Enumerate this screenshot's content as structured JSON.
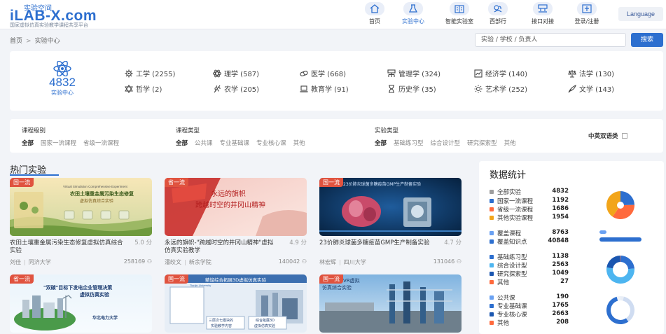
{
  "header": {
    "logo_cn": "实验空间",
    "logo_en": "iLAB-X.com",
    "logo_sub": "国家虚拟仿真实验教学课程共享平台",
    "nav": [
      {
        "label": "首页",
        "icon": "home-icon"
      },
      {
        "label": "实验中心",
        "icon": "flask-icon"
      },
      {
        "label": "智能实验室",
        "icon": "book-icon"
      },
      {
        "label": "西部行",
        "icon": "handshake-icon"
      },
      {
        "label": "接口对接",
        "icon": "network-icon"
      },
      {
        "label": "登录/注册",
        "icon": "user-login-icon"
      }
    ],
    "active_nav": "实验中心",
    "language": "Language"
  },
  "breadcrumb": {
    "home": "首页",
    "sep": ">",
    "current": "实验中心"
  },
  "search": {
    "placeholder": "实验 / 学校 / 负责人",
    "button": "搜索"
  },
  "categories": {
    "total": "4832",
    "total_label": "实验中心",
    "items": [
      {
        "label": "工学 (2255)",
        "icon": "gear-icon"
      },
      {
        "label": "理学 (587)",
        "icon": "atom-icon"
      },
      {
        "label": "医学 (668)",
        "icon": "pill-icon"
      },
      {
        "label": "管理学 (324)",
        "icon": "org-chart-icon"
      },
      {
        "label": "经济学 (140)",
        "icon": "chart-line-icon"
      },
      {
        "label": "法学 (130)",
        "icon": "scales-icon"
      },
      {
        "label": "哲学 (2)",
        "icon": "star-of-david-icon"
      },
      {
        "label": "农学 (205)",
        "icon": "wheat-icon"
      },
      {
        "label": "教育学 (91)",
        "icon": "laptop-icon"
      },
      {
        "label": "历史学 (35)",
        "icon": "hourglass-icon"
      },
      {
        "label": "艺术学 (252)",
        "icon": "sun-icon"
      },
      {
        "label": "文学 (143)",
        "icon": "quill-icon"
      }
    ]
  },
  "filters": {
    "groups": [
      {
        "title": "课程级别",
        "options": [
          "全部",
          "国家一流课程",
          "省级一流课程"
        ]
      },
      {
        "title": "课程类型",
        "options": [
          "全部",
          "公共课",
          "专业基础课",
          "专业核心课",
          "其他"
        ]
      },
      {
        "title": "实验类型",
        "options": [
          "全部",
          "基础练习型",
          "综合设计型",
          "研究探索型",
          "其他"
        ]
      }
    ],
    "bilingual": "中英双语类"
  },
  "hot": {
    "title": "热门实验",
    "cards": [
      {
        "badge": "国一流",
        "image_text": [
          "Virtual Simulation Comprehensive Experiment",
          "农田土壤重金属污染生态修复",
          "虚拟仿真综合实验"
        ],
        "title": "农田土壤重金属污染生态修复虚拟仿真综合实验",
        "score": "5.0 分",
        "author": "刘佳",
        "school": "同济大学",
        "views": "258169"
      },
      {
        "badge": "省一流",
        "image_text": [
          "永远的旗帜",
          "跨越时空的井冈山精神"
        ],
        "title": "永远的旗帜-\"跨越时空的井冈山精神\"虚拟仿真实验教学",
        "score": "4.9 分",
        "author": "潘皎文",
        "school": "新余学院",
        "views": "140042"
      },
      {
        "badge": "国一流",
        "image_text": [
          "23价肺炎球菌多糖疫苗GMP生产制备实验"
        ],
        "title": "23价肺炎球菌多糖疫苗GMP生产制备实验",
        "score": "4.7 分",
        "author": "林宏辉",
        "school": "四川大学",
        "views": "131046"
      },
      {
        "badge": "省一流",
        "image_text": [
          "\"双碳\"目标下发电企业管理决策",
          "虚拟仿真实验",
          "华北电力大学"
        ]
      },
      {
        "badge": "国一流",
        "image_text": [
          "精馏综合拓展3D虚拟仿真实验",
          "Tianjin University",
          "三层次七模块的",
          "实验教学内容",
          "综合拓展3D",
          "虚拟仿真实验"
        ]
      },
      {
        "badge": "国一流",
        "image_text": [
          "VR虚拟",
          "仿真综合实验"
        ]
      }
    ]
  },
  "stats": {
    "title": "数据统计",
    "groups": [
      {
        "rows": [
          {
            "label": "全部实验",
            "value": "4832",
            "color": "#9e9e9e"
          },
          {
            "label": "国家一流课程",
            "value": "1192",
            "color": "#2d6fcf"
          },
          {
            "label": "省级一流课程",
            "value": "1686",
            "color": "#ff6a3d"
          },
          {
            "label": "其他实验课程",
            "value": "1954",
            "color": "#f2a51a"
          }
        ],
        "pie": [
          1192,
          1686,
          1954
        ]
      },
      {
        "rows": [
          {
            "label": "覆盖课程",
            "value": "8763",
            "color": "#6aa1f2"
          },
          {
            "label": "覆盖知识点",
            "value": "40848",
            "color": "#2d6fcf"
          }
        ]
      },
      {
        "rows": [
          {
            "label": "基础练习型",
            "value": "1138",
            "color": "#2d6fcf"
          },
          {
            "label": "综合设计型",
            "value": "2563",
            "color": "#4db5f0"
          },
          {
            "label": "研究探索型",
            "value": "1049",
            "color": "#1a56b0"
          },
          {
            "label": "其他",
            "value": "27",
            "color": "#ff6a3d"
          }
        ],
        "pie": [
          1138,
          2563,
          1049,
          27
        ]
      },
      {
        "rows": [
          {
            "label": "公共课",
            "value": "190",
            "color": "#6aa1f2"
          },
          {
            "label": "专业基础课",
            "value": "1765",
            "color": "#2d6fcf"
          },
          {
            "label": "专业核心课",
            "value": "2663",
            "color": "#1a56b0"
          },
          {
            "label": "其他",
            "value": "208",
            "color": "#ff6a3d"
          }
        ],
        "pie": [
          190,
          1765,
          2663,
          208
        ]
      }
    ]
  }
}
